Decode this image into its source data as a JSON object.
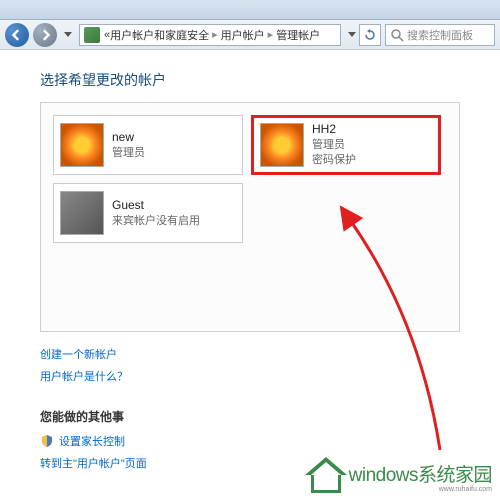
{
  "breadcrumb": {
    "part1": "用户帐户和家庭安全",
    "part2": "用户帐户",
    "part3": "管理帐户"
  },
  "search": {
    "placeholder": "搜索控制面板"
  },
  "section_title": "选择希望更改的帐户",
  "accounts": [
    {
      "name": "new",
      "role": "管理员",
      "extra": "",
      "avatar": "flower",
      "highlighted": false
    },
    {
      "name": "HH2",
      "role": "管理员",
      "extra": "密码保护",
      "avatar": "flower",
      "highlighted": true
    },
    {
      "name": "Guest",
      "role": "来宾帐户没有启用",
      "extra": "",
      "avatar": "guest",
      "highlighted": false
    }
  ],
  "links": {
    "create": "创建一个新帐户",
    "whatis": "用户帐户是什么？"
  },
  "other": {
    "title": "您能做的其他事",
    "parental": "设置家长控制",
    "goto_main": "转到主\"用户帐户\"页面"
  },
  "watermark": {
    "main": "windows系统家园",
    "sub": "www.ruhaifu.com"
  }
}
